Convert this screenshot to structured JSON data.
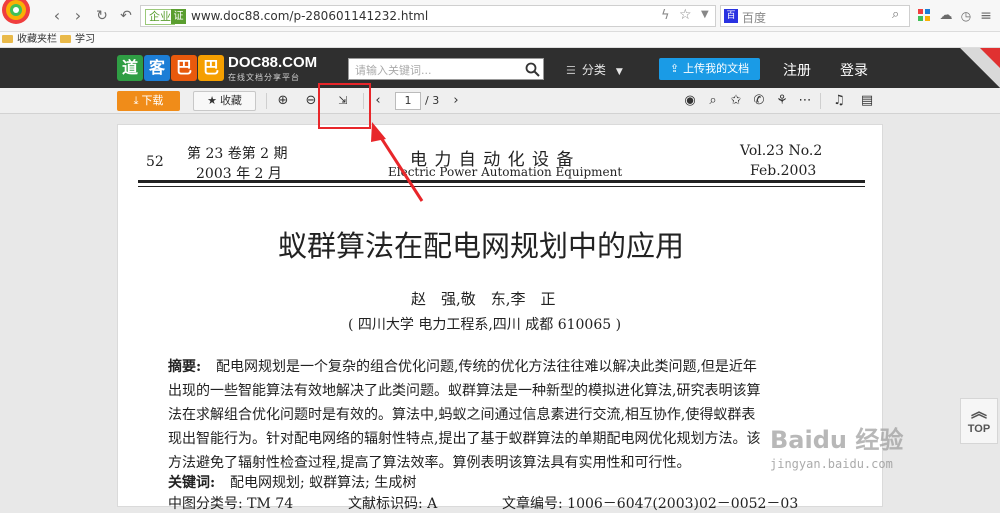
{
  "browser": {
    "badge_qiye": "企业",
    "badge_zheng": "证",
    "url": "www.doc88.com/p-280601141232.html",
    "search_engine": "百度",
    "bookmarks": [
      "收藏夹栏",
      "学习"
    ]
  },
  "site": {
    "logo_chars": [
      "道",
      "客",
      "巴",
      "巴"
    ],
    "logo_colors": [
      "#2f9e44",
      "#1c7ed6",
      "#e8590c",
      "#f59f00"
    ],
    "logo_name": "DOC88.COM",
    "logo_sub": "在线文档分享平台",
    "search_placeholder": "请输入关键词...",
    "category": "分类",
    "upload": "上传我的文档",
    "register": "注册",
    "login": "登录"
  },
  "toolbar": {
    "download": "下载",
    "favorite": "收藏",
    "current_page": "1",
    "total_pages": "/ 3"
  },
  "document": {
    "page_num": "52",
    "issue_cn": "第 23 卷第 2 期",
    "date_cn": "2003 年 2 月",
    "journal_cn": "电 力 自 动 化 设 备",
    "journal_en": "Electric Power Automation Equipment",
    "vol_en": "Vol.23  No.2",
    "date_en": "Feb.2003",
    "title": "蚁群算法在配电网规划中的应用",
    "authors": "赵　强,敬　东,李　正",
    "affiliation": "( 四川大学  电力工程系,四川  成都  610065 )",
    "abstract_label": "摘要:",
    "abstract_lines": [
      "配电网规划是一个复杂的组合优化问题,传统的优化方法往往难以解决此类问题,但是近年",
      "出现的一些智能算法有效地解决了此类问题。蚁群算法是一种新型的模拟进化算法,研究表明该算",
      "法在求解组合优化问题时是有效的。算法中,蚂蚁之间通过信息素进行交流,相互协作,使得蚁群表",
      "现出智能行为。针对配电网络的辐射性特点,提出了基于蚁群算法的单期配电网优化规划方法。该",
      "方法避免了辐射性检查过程,提高了算法效率。算例表明该算法具有实用性和可行性。"
    ],
    "keywords_label": "关键词:",
    "keywords": "配电网规划;  蚁群算法;  生成树",
    "class_no": "中图分类号:  TM 74",
    "doc_code": "文献标识码:  A",
    "article_no": "文章编号:  1006－6047(2003)02－0052－03"
  },
  "widgets": {
    "top_label": "TOP",
    "watermark": "Baidu 经验",
    "watermark_url": "jingyan.baidu.com"
  }
}
